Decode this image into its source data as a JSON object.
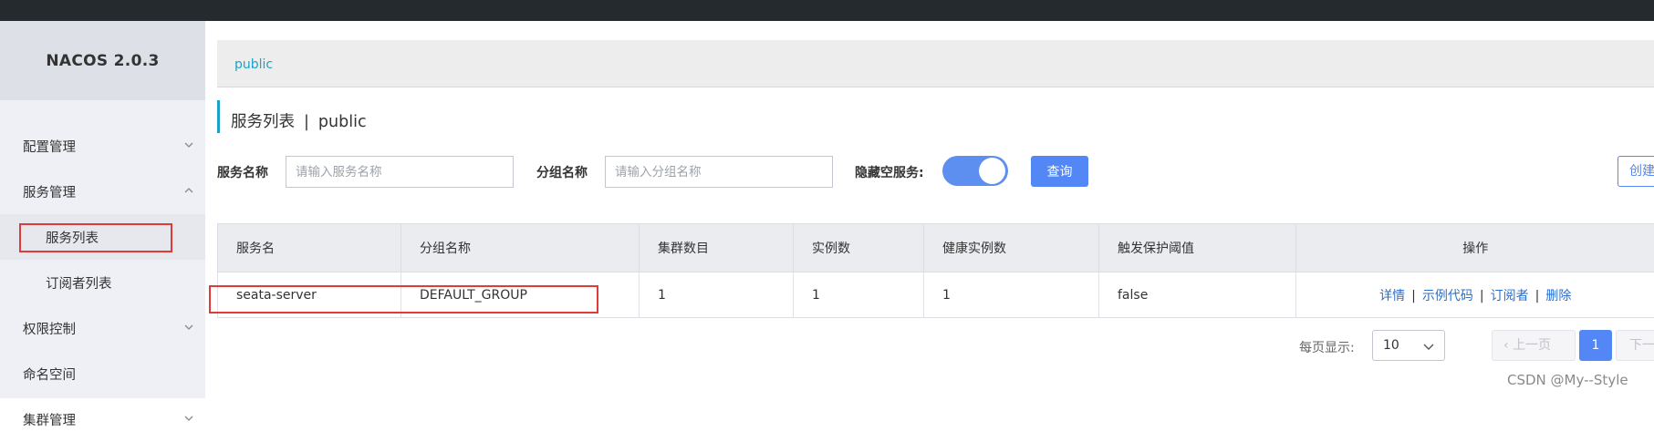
{
  "app": {
    "logo": "NACOS 2.0.3"
  },
  "sidebar": {
    "items": [
      {
        "label": "配置管理"
      },
      {
        "label": "服务管理"
      },
      {
        "label": "服务列表"
      },
      {
        "label": "订阅者列表"
      },
      {
        "label": "权限控制"
      },
      {
        "label": "命名空间"
      },
      {
        "label": "集群管理"
      }
    ]
  },
  "breadcrumb": {
    "namespace": "public"
  },
  "page": {
    "title": "服务列表",
    "separator": "|",
    "namespace": "public"
  },
  "filters": {
    "service_name_label": "服务名称",
    "service_name_placeholder": "请输入服务名称",
    "group_name_label": "分组名称",
    "group_name_placeholder": "请输入分组名称",
    "hide_empty_label": "隐藏空服务:",
    "hide_empty_on": true,
    "query_button": "查询",
    "create_button": "创建服务"
  },
  "table": {
    "headers": [
      "服务名",
      "分组名称",
      "集群数目",
      "实例数",
      "健康实例数",
      "触发保护阈值",
      "操作"
    ],
    "rows": [
      {
        "service": "seata-server",
        "group": "DEFAULT_GROUP",
        "clusters": "1",
        "instances": "1",
        "healthy": "1",
        "threshold": "false",
        "ops": [
          "详情",
          "示例代码",
          "订阅者",
          "删除"
        ]
      }
    ]
  },
  "pagination": {
    "page_size_label": "每页显示:",
    "page_size": "10",
    "prev": "上一页",
    "current": "1",
    "next": "下一页"
  },
  "watermark": "CSDN @My--Style",
  "colors": {
    "accent": "#1ba3c6",
    "primary": "#5287f5",
    "link": "#2a6fce",
    "highlight_box": "#e03a3a",
    "topbar": "#252a2f"
  }
}
